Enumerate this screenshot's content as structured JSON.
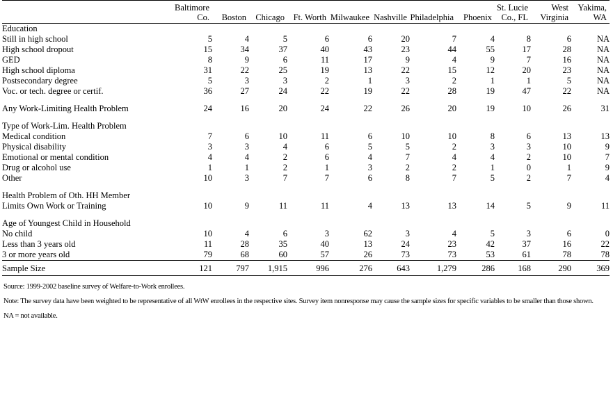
{
  "table": {
    "columns": [
      "Baltimore\nCo.",
      "Boston",
      "Chicago",
      "Ft. Worth",
      "Milwaukee",
      "Nashville",
      "Philadelphia",
      "Phoenix",
      "St. Lucie\nCo., FL",
      "West\nVirginia",
      "Yakima,\nWA"
    ],
    "rows": [
      {
        "label": "Education",
        "indent": 0,
        "values": [
          "",
          "",
          "",
          "",
          "",
          "",
          "",
          "",
          "",
          "",
          ""
        ]
      },
      {
        "label": "Still in high school",
        "indent": 1,
        "values": [
          "5",
          "4",
          "5",
          "6",
          "6",
          "20",
          "7",
          "4",
          "8",
          "6",
          "NA"
        ]
      },
      {
        "label": "High school dropout",
        "indent": 1,
        "values": [
          "15",
          "34",
          "37",
          "40",
          "43",
          "23",
          "44",
          "55",
          "17",
          "28",
          "NA"
        ]
      },
      {
        "label": "GED",
        "indent": 1,
        "values": [
          "8",
          "9",
          "6",
          "11",
          "17",
          "9",
          "4",
          "9",
          "7",
          "16",
          "NA"
        ]
      },
      {
        "label": "High school diploma",
        "indent": 1,
        "values": [
          "31",
          "22",
          "25",
          "19",
          "13",
          "22",
          "15",
          "12",
          "20",
          "23",
          "NA"
        ]
      },
      {
        "label": "Postsecondary degree",
        "indent": 1,
        "values": [
          "5",
          "3",
          "3",
          "2",
          "1",
          "3",
          "2",
          "1",
          "1",
          "5",
          "NA"
        ]
      },
      {
        "label": "Voc. or tech. degree or certif.",
        "indent": 1,
        "values": [
          "36",
          "27",
          "24",
          "22",
          "19",
          "22",
          "28",
          "19",
          "47",
          "22",
          "NA"
        ]
      },
      {
        "gap": true
      },
      {
        "label": "Any Work-Limiting Health Problem",
        "indent": 0,
        "values": [
          "24",
          "16",
          "20",
          "24",
          "22",
          "26",
          "20",
          "19",
          "10",
          "26",
          "31"
        ]
      },
      {
        "gap": true
      },
      {
        "label": "Type of Work-Lim. Health Problem",
        "indent": 0,
        "values": [
          "",
          "",
          "",
          "",
          "",
          "",
          "",
          "",
          "",
          "",
          ""
        ]
      },
      {
        "label": "Medical condition",
        "indent": 1,
        "values": [
          "7",
          "6",
          "10",
          "11",
          "6",
          "10",
          "10",
          "8",
          "6",
          "13",
          "13"
        ]
      },
      {
        "label": "Physical disability",
        "indent": 1,
        "values": [
          "3",
          "3",
          "4",
          "6",
          "5",
          "5",
          "2",
          "3",
          "3",
          "10",
          "9"
        ]
      },
      {
        "label": "Emotional or mental condition",
        "indent": 1,
        "values": [
          "4",
          "4",
          "2",
          "6",
          "4",
          "7",
          "4",
          "4",
          "2",
          "10",
          "7"
        ]
      },
      {
        "label": "Drug or alcohol use",
        "indent": 1,
        "values": [
          "1",
          "1",
          "2",
          "1",
          "3",
          "2",
          "2",
          "1",
          "0",
          "1",
          "9"
        ]
      },
      {
        "label": "Other",
        "indent": 1,
        "values": [
          "10",
          "3",
          "7",
          "7",
          "6",
          "8",
          "7",
          "5",
          "2",
          "7",
          "4"
        ]
      },
      {
        "gap": true
      },
      {
        "label": "Health Problem of Oth. HH Member",
        "indent": 0,
        "values": [
          "",
          "",
          "",
          "",
          "",
          "",
          "",
          "",
          "",
          "",
          ""
        ]
      },
      {
        "label": "Limits Own Work or Training",
        "indent": 2,
        "values": [
          "10",
          "9",
          "11",
          "11",
          "4",
          "13",
          "13",
          "14",
          "5",
          "9",
          "11"
        ]
      },
      {
        "gap": true
      },
      {
        "label": "Age of Youngest Child in Household",
        "indent": 0,
        "values": [
          "",
          "",
          "",
          "",
          "",
          "",
          "",
          "",
          "",
          "",
          ""
        ]
      },
      {
        "label": "No child",
        "indent": 1,
        "values": [
          "10",
          "4",
          "6",
          "3",
          "62",
          "3",
          "4",
          "5",
          "3",
          "6",
          "0"
        ]
      },
      {
        "label": "Less than 3 years old",
        "indent": 1,
        "values": [
          "11",
          "28",
          "35",
          "40",
          "13",
          "24",
          "23",
          "42",
          "37",
          "16",
          "22"
        ]
      },
      {
        "label": "3 or more years old",
        "indent": 1,
        "values": [
          "79",
          "68",
          "60",
          "57",
          "26",
          "73",
          "73",
          "53",
          "61",
          "78",
          "78"
        ]
      }
    ],
    "sample_size": {
      "label": "Sample Size",
      "values": [
        "121",
        "797",
        "1,915",
        "996",
        "276",
        "643",
        "1,279",
        "286",
        "168",
        "290",
        "369"
      ]
    }
  },
  "notes": {
    "source": "Source:  1999-2002 baseline survey of Welfare-to-Work enrollees.",
    "note": "Note:  The survey data have been weighted to be representative of all WtW enrollees in the respective sites.  Survey item nonresponse may cause the sample sizes for specific variables to be smaller than those shown.",
    "na": "NA = not available."
  }
}
